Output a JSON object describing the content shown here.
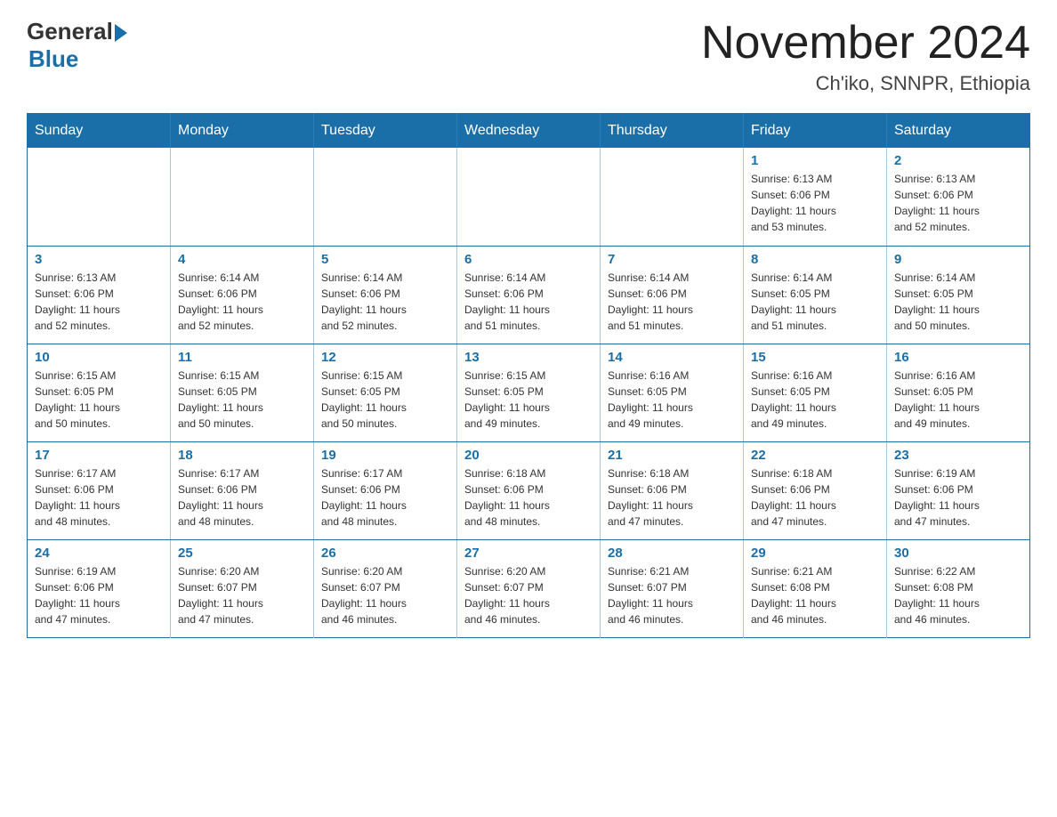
{
  "logo": {
    "general": "General",
    "blue": "Blue"
  },
  "title": "November 2024",
  "subtitle": "Ch'iko, SNNPR, Ethiopia",
  "days_of_week": [
    "Sunday",
    "Monday",
    "Tuesday",
    "Wednesday",
    "Thursday",
    "Friday",
    "Saturday"
  ],
  "weeks": [
    [
      {
        "day": "",
        "info": ""
      },
      {
        "day": "",
        "info": ""
      },
      {
        "day": "",
        "info": ""
      },
      {
        "day": "",
        "info": ""
      },
      {
        "day": "",
        "info": ""
      },
      {
        "day": "1",
        "info": "Sunrise: 6:13 AM\nSunset: 6:06 PM\nDaylight: 11 hours\nand 53 minutes."
      },
      {
        "day": "2",
        "info": "Sunrise: 6:13 AM\nSunset: 6:06 PM\nDaylight: 11 hours\nand 52 minutes."
      }
    ],
    [
      {
        "day": "3",
        "info": "Sunrise: 6:13 AM\nSunset: 6:06 PM\nDaylight: 11 hours\nand 52 minutes."
      },
      {
        "day": "4",
        "info": "Sunrise: 6:14 AM\nSunset: 6:06 PM\nDaylight: 11 hours\nand 52 minutes."
      },
      {
        "day": "5",
        "info": "Sunrise: 6:14 AM\nSunset: 6:06 PM\nDaylight: 11 hours\nand 52 minutes."
      },
      {
        "day": "6",
        "info": "Sunrise: 6:14 AM\nSunset: 6:06 PM\nDaylight: 11 hours\nand 51 minutes."
      },
      {
        "day": "7",
        "info": "Sunrise: 6:14 AM\nSunset: 6:06 PM\nDaylight: 11 hours\nand 51 minutes."
      },
      {
        "day": "8",
        "info": "Sunrise: 6:14 AM\nSunset: 6:05 PM\nDaylight: 11 hours\nand 51 minutes."
      },
      {
        "day": "9",
        "info": "Sunrise: 6:14 AM\nSunset: 6:05 PM\nDaylight: 11 hours\nand 50 minutes."
      }
    ],
    [
      {
        "day": "10",
        "info": "Sunrise: 6:15 AM\nSunset: 6:05 PM\nDaylight: 11 hours\nand 50 minutes."
      },
      {
        "day": "11",
        "info": "Sunrise: 6:15 AM\nSunset: 6:05 PM\nDaylight: 11 hours\nand 50 minutes."
      },
      {
        "day": "12",
        "info": "Sunrise: 6:15 AM\nSunset: 6:05 PM\nDaylight: 11 hours\nand 50 minutes."
      },
      {
        "day": "13",
        "info": "Sunrise: 6:15 AM\nSunset: 6:05 PM\nDaylight: 11 hours\nand 49 minutes."
      },
      {
        "day": "14",
        "info": "Sunrise: 6:16 AM\nSunset: 6:05 PM\nDaylight: 11 hours\nand 49 minutes."
      },
      {
        "day": "15",
        "info": "Sunrise: 6:16 AM\nSunset: 6:05 PM\nDaylight: 11 hours\nand 49 minutes."
      },
      {
        "day": "16",
        "info": "Sunrise: 6:16 AM\nSunset: 6:05 PM\nDaylight: 11 hours\nand 49 minutes."
      }
    ],
    [
      {
        "day": "17",
        "info": "Sunrise: 6:17 AM\nSunset: 6:06 PM\nDaylight: 11 hours\nand 48 minutes."
      },
      {
        "day": "18",
        "info": "Sunrise: 6:17 AM\nSunset: 6:06 PM\nDaylight: 11 hours\nand 48 minutes."
      },
      {
        "day": "19",
        "info": "Sunrise: 6:17 AM\nSunset: 6:06 PM\nDaylight: 11 hours\nand 48 minutes."
      },
      {
        "day": "20",
        "info": "Sunrise: 6:18 AM\nSunset: 6:06 PM\nDaylight: 11 hours\nand 48 minutes."
      },
      {
        "day": "21",
        "info": "Sunrise: 6:18 AM\nSunset: 6:06 PM\nDaylight: 11 hours\nand 47 minutes."
      },
      {
        "day": "22",
        "info": "Sunrise: 6:18 AM\nSunset: 6:06 PM\nDaylight: 11 hours\nand 47 minutes."
      },
      {
        "day": "23",
        "info": "Sunrise: 6:19 AM\nSunset: 6:06 PM\nDaylight: 11 hours\nand 47 minutes."
      }
    ],
    [
      {
        "day": "24",
        "info": "Sunrise: 6:19 AM\nSunset: 6:06 PM\nDaylight: 11 hours\nand 47 minutes."
      },
      {
        "day": "25",
        "info": "Sunrise: 6:20 AM\nSunset: 6:07 PM\nDaylight: 11 hours\nand 47 minutes."
      },
      {
        "day": "26",
        "info": "Sunrise: 6:20 AM\nSunset: 6:07 PM\nDaylight: 11 hours\nand 46 minutes."
      },
      {
        "day": "27",
        "info": "Sunrise: 6:20 AM\nSunset: 6:07 PM\nDaylight: 11 hours\nand 46 minutes."
      },
      {
        "day": "28",
        "info": "Sunrise: 6:21 AM\nSunset: 6:07 PM\nDaylight: 11 hours\nand 46 minutes."
      },
      {
        "day": "29",
        "info": "Sunrise: 6:21 AM\nSunset: 6:08 PM\nDaylight: 11 hours\nand 46 minutes."
      },
      {
        "day": "30",
        "info": "Sunrise: 6:22 AM\nSunset: 6:08 PM\nDaylight: 11 hours\nand 46 minutes."
      }
    ]
  ]
}
